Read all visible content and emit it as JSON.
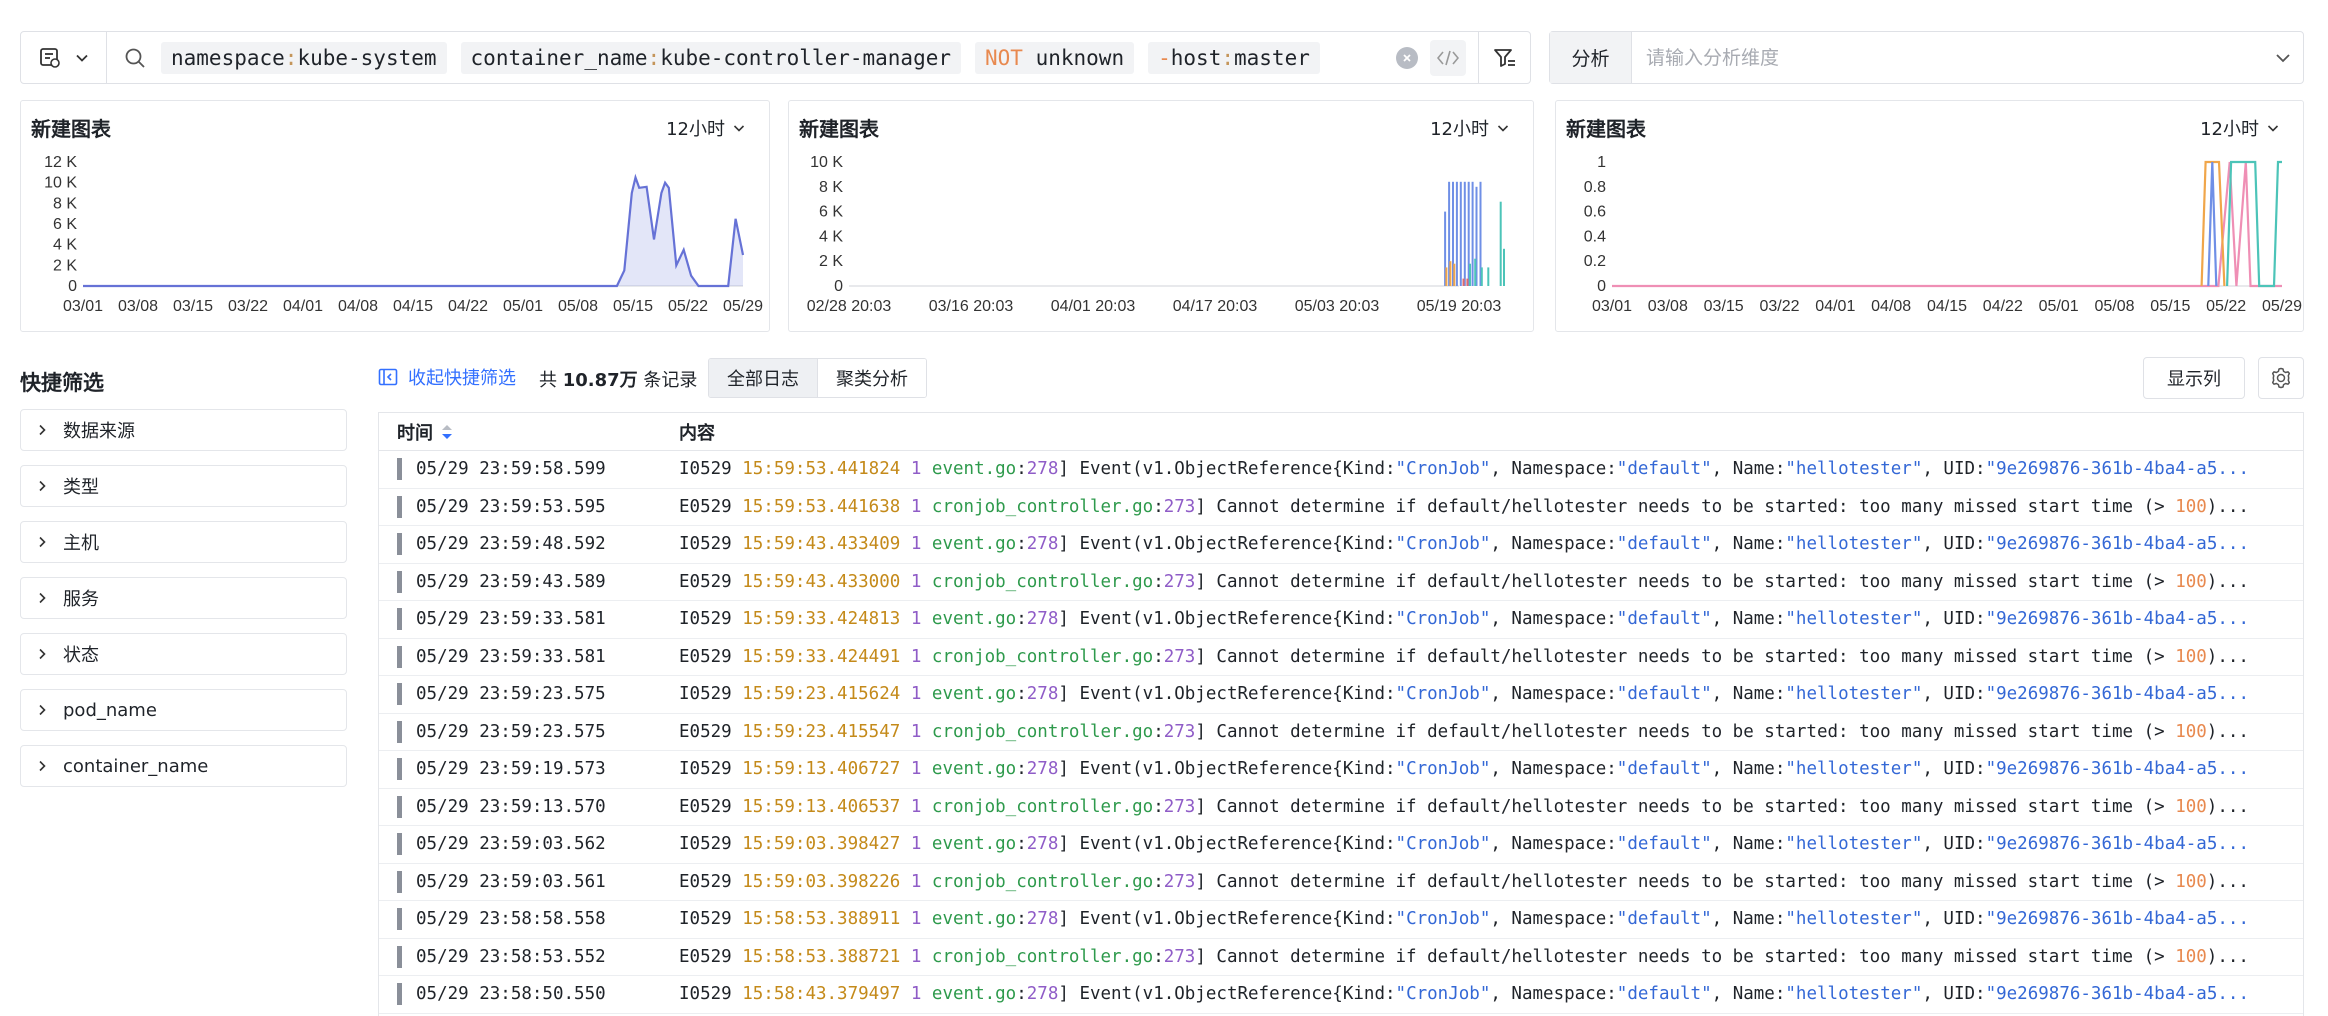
{
  "query": {
    "tokens": [
      {
        "op": "",
        "key": "namespace",
        "sep": ":",
        "value": "kube-system"
      },
      {
        "op": "",
        "key": "container_name",
        "sep": ":",
        "value": "kube-controller-manager"
      },
      {
        "op": "NOT",
        "key": "",
        "sep": "",
        "value": "unknown"
      },
      {
        "op": "-",
        "key": "host",
        "sep": ":",
        "value": "master"
      }
    ]
  },
  "analysis": {
    "label": "分析",
    "placeholder": "请输入分析维度"
  },
  "charts": [
    {
      "title": "新建图表",
      "range_label": "12小时",
      "chart_data": {
        "type": "area",
        "y_ticks": [
          "12 K",
          "10 K",
          "8 K",
          "6 K",
          "4 K",
          "2 K",
          "0"
        ],
        "ylim": [
          0,
          12000
        ],
        "x_ticks": [
          "03/01",
          "03/08",
          "03/15",
          "03/22",
          "04/01",
          "04/08",
          "04/15",
          "04/22",
          "05/01",
          "05/08",
          "05/15",
          "05/22",
          "05/29"
        ],
        "series": [
          {
            "color": "#6672d6",
            "points": [
              [
                "03/01",
                0
              ],
              [
                "05/12",
                0
              ],
              [
                "05/13",
                1500
              ],
              [
                "05/14",
                9000
              ],
              [
                "05/14.5",
                10500
              ],
              [
                "05/15",
                9500
              ],
              [
                "05/16",
                9600
              ],
              [
                "05/17",
                4500
              ],
              [
                "05/18",
                9000
              ],
              [
                "05/18.5",
                10000
              ],
              [
                "05/19",
                9500
              ],
              [
                "05/20",
                2000
              ],
              [
                "05/21",
                3500
              ],
              [
                "05/22",
                1000
              ],
              [
                "05/23",
                0
              ],
              [
                "05/27",
                0
              ],
              [
                "05/28",
                6500
              ],
              [
                "05/29",
                3000
              ]
            ]
          }
        ]
      }
    },
    {
      "title": "新建图表",
      "range_label": "12小时",
      "chart_data": {
        "type": "bar",
        "y_ticks": [
          "10 K",
          "8 K",
          "6 K",
          "4 K",
          "2 K",
          "0"
        ],
        "ylim": [
          0,
          10000
        ],
        "x_ticks": [
          "02/28 20:03",
          "03/16 20:03",
          "04/01 20:03",
          "04/17 20:03",
          "05/03 20:03",
          "05/19 20:03"
        ],
        "series": [
          {
            "color": "#6f8fe6",
            "values": [
              [
                0.91,
                6000
              ],
              [
                0.916,
                8400
              ],
              [
                0.922,
                8400
              ],
              [
                0.928,
                8400
              ],
              [
                0.934,
                8400
              ],
              [
                0.94,
                8400
              ],
              [
                0.946,
                8400
              ],
              [
                0.952,
                8400
              ],
              [
                0.958,
                8000
              ],
              [
                0.964,
                8400
              ]
            ]
          },
          {
            "color": "#f0a64a",
            "values": [
              [
                0.912,
                1500
              ],
              [
                0.918,
                2000
              ],
              [
                0.924,
                1800
              ]
            ]
          },
          {
            "color": "#e06b6b",
            "values": [
              [
                0.938,
                600
              ],
              [
                0.944,
                600
              ]
            ]
          },
          {
            "color": "#4cc4b8",
            "values": [
              [
                0.948,
                1800
              ],
              [
                0.956,
                2200
              ],
              [
                0.966,
                1500
              ],
              [
                0.976,
                1500
              ],
              [
                0.995,
                6800
              ],
              [
                1.0,
                3000
              ]
            ]
          }
        ]
      }
    },
    {
      "title": "新建图表",
      "range_label": "12小时",
      "chart_data": {
        "type": "line",
        "y_ticks": [
          "1",
          "0.8",
          "0.6",
          "0.4",
          "0.2",
          "0"
        ],
        "ylim": [
          0,
          1
        ],
        "x_ticks": [
          "03/01",
          "03/08",
          "03/15",
          "03/22",
          "04/01",
          "04/08",
          "04/15",
          "04/22",
          "05/01",
          "05/08",
          "05/15",
          "05/22",
          "05/29"
        ],
        "series": [
          {
            "color": "#ef8fb5",
            "points": [
              [
                0.0,
                0
              ],
              [
                0.905,
                0
              ],
              [
                0.922,
                1
              ],
              [
                0.932,
                0
              ],
              [
                0.946,
                1
              ],
              [
                0.953,
                0
              ],
              [
                1.0,
                0
              ]
            ]
          },
          {
            "color": "#f0a64a",
            "points": [
              [
                0.88,
                0
              ],
              [
                0.886,
                1
              ],
              [
                0.906,
                1
              ],
              [
                0.914,
                0
              ]
            ]
          },
          {
            "color": "#6f8fe6",
            "points": [
              [
                0.89,
                0
              ],
              [
                0.896,
                1
              ],
              [
                0.902,
                0
              ]
            ]
          },
          {
            "color": "#4cc4b8",
            "points": [
              [
                0.918,
                0
              ],
              [
                0.924,
                1
              ],
              [
                0.96,
                1
              ],
              [
                0.966,
                0
              ],
              [
                0.988,
                0
              ],
              [
                0.994,
                1
              ],
              [
                1.0,
                1
              ]
            ]
          }
        ]
      }
    }
  ],
  "quick_filter": {
    "title": "快捷筛选",
    "items": [
      "数据来源",
      "类型",
      "主机",
      "服务",
      "状态",
      "pod_name",
      "container_name"
    ]
  },
  "toolbar": {
    "collapse_label": "收起快捷筛选",
    "total_prefix": "共",
    "total_count": "10.87万",
    "total_suffix": "条记录",
    "tabs": [
      "全部日志",
      "聚类分析"
    ],
    "show_columns_label": "显示列"
  },
  "table": {
    "headers": {
      "time": "时间",
      "content": "内容"
    },
    "rows": [
      {
        "time": "05/29 23:59:58.599",
        "level": "I0529",
        "ts": "15:59:53.441824",
        "type": "event"
      },
      {
        "time": "05/29 23:59:53.595",
        "level": "E0529",
        "ts": "15:59:53.441638",
        "type": "cron"
      },
      {
        "time": "05/29 23:59:48.592",
        "level": "I0529",
        "ts": "15:59:43.433409",
        "type": "event"
      },
      {
        "time": "05/29 23:59:43.589",
        "level": "E0529",
        "ts": "15:59:43.433000",
        "type": "cron"
      },
      {
        "time": "05/29 23:59:33.581",
        "level": "I0529",
        "ts": "15:59:33.424813",
        "type": "event"
      },
      {
        "time": "05/29 23:59:33.581",
        "level": "E0529",
        "ts": "15:59:33.424491",
        "type": "cron"
      },
      {
        "time": "05/29 23:59:23.575",
        "level": "I0529",
        "ts": "15:59:23.415624",
        "type": "event"
      },
      {
        "time": "05/29 23:59:23.575",
        "level": "E0529",
        "ts": "15:59:23.415547",
        "type": "cron"
      },
      {
        "time": "05/29 23:59:19.573",
        "level": "I0529",
        "ts": "15:59:13.406727",
        "type": "event"
      },
      {
        "time": "05/29 23:59:13.570",
        "level": "E0529",
        "ts": "15:59:13.406537",
        "type": "cron"
      },
      {
        "time": "05/29 23:59:03.562",
        "level": "I0529",
        "ts": "15:59:03.398427",
        "type": "event"
      },
      {
        "time": "05/29 23:59:03.561",
        "level": "E0529",
        "ts": "15:59:03.398226",
        "type": "cron"
      },
      {
        "time": "05/29 23:58:58.558",
        "level": "I0529",
        "ts": "15:58:53.388911",
        "type": "event"
      },
      {
        "time": "05/29 23:58:53.552",
        "level": "E0529",
        "ts": "15:58:53.388721",
        "type": "cron"
      },
      {
        "time": "05/29 23:58:50.550",
        "level": "I0529",
        "ts": "15:58:43.379497",
        "type": "event"
      }
    ],
    "templates": {
      "event": {
        "pid": "1",
        "file": "event.go",
        "line": "278",
        "text_a": "] Event(v1.ObjectReference{Kind:",
        "kind": "\"CronJob\"",
        "text_b": ", Namespace:",
        "ns": "\"default\"",
        "text_c": ", Name:",
        "name": "\"hellotester\"",
        "text_d": ", UID:",
        "uid": "\"9e269876-361b-4ba4-a5..."
      },
      "cron": {
        "pid": "1",
        "file": "cronjob_controller.go",
        "line": "273",
        "text_a": "] Cannot determine if default/hellotester needs to be started: too many missed start time (> ",
        "num": "100",
        "text_b": ")..."
      }
    }
  },
  "colors": {
    "accent": "#3370ff",
    "timestamp": "#c48a1a",
    "file": "#2e9a4c",
    "string": "#3468d6"
  }
}
